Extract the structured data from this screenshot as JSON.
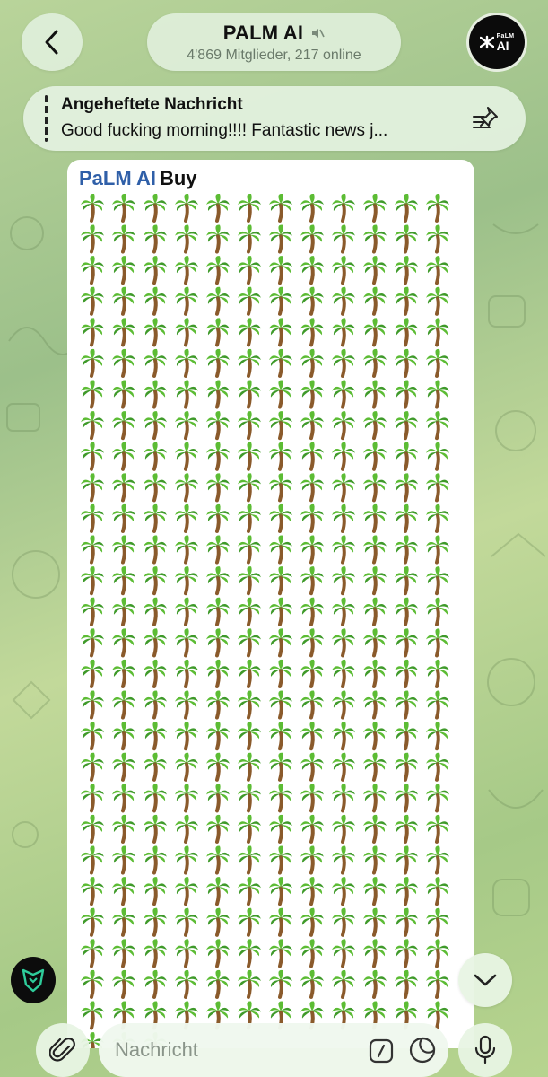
{
  "header": {
    "back_icon": "chevron-left-icon",
    "title": "PALM AI",
    "muted_icon": "muted-speaker-icon",
    "subtitle": "4'869 Mitglieder, 217 online",
    "avatar": {
      "small_text": "PaLM",
      "big_text": "AI"
    }
  },
  "pinned": {
    "title": "Angeheftete Nachricht",
    "text": "Good fucking morning!!!! Fantastic news j...",
    "icon": "pin-list-icon"
  },
  "message": {
    "sender": "PaLM AI",
    "text": "Buy",
    "emoji": "🌴",
    "emoji_count": 327,
    "columns": 12
  },
  "composer": {
    "placeholder": "Nachricht",
    "attach_icon": "paperclip-icon",
    "command_icon": "slash-command-icon",
    "sticker_icon": "sticker-icon",
    "mic_icon": "microphone-icon"
  },
  "scroll_down_icon": "chevron-down-icon",
  "side_logo_icon": "shield-logo-icon",
  "colors": {
    "accent": "#2f5fa8",
    "bubble": "#ffffff"
  }
}
